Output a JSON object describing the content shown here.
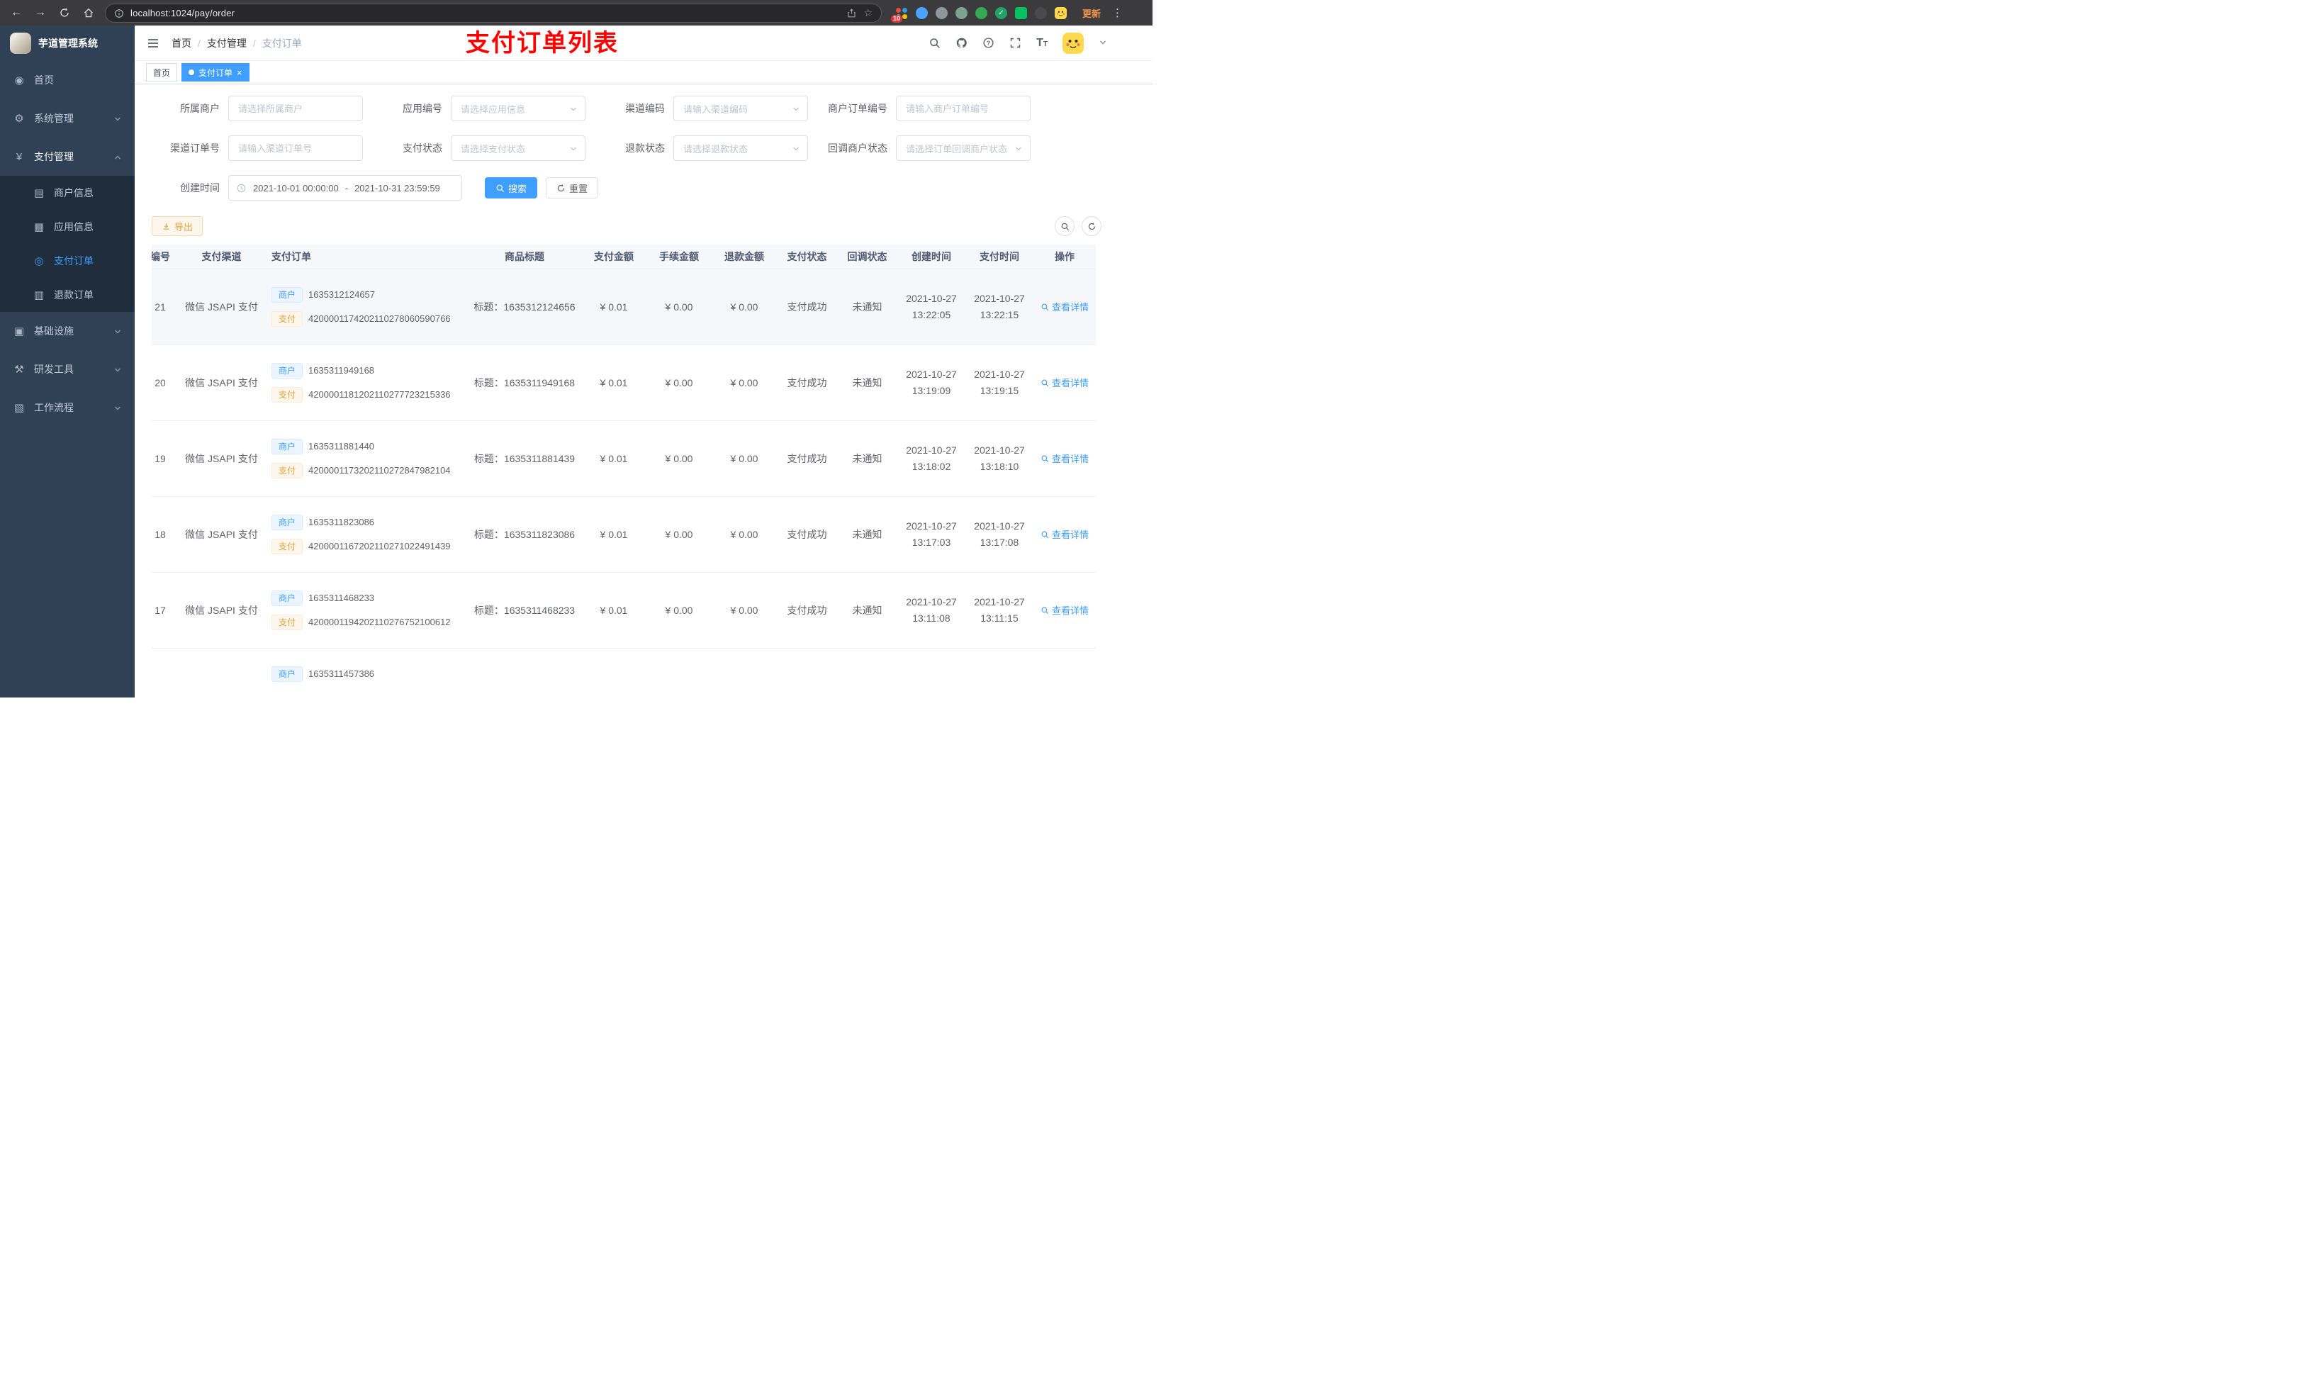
{
  "browser": {
    "url": "localhost:1024/pay/order",
    "extension_badge": "10",
    "update_label": "更新"
  },
  "icons": {
    "back": "←",
    "forward": "→",
    "star": "☆",
    "more": "⋮",
    "close": "×",
    "check": "✓",
    "font_size_large": "T",
    "font_size_small": "T",
    "menu_dashboard": "◉",
    "menu_system": "⚙",
    "menu_payment": "¥",
    "menu_merchant": "▤",
    "menu_app": "▦",
    "menu_pay_order": "◎",
    "menu_refund": "▥",
    "menu_infra": "▣",
    "menu_dev": "⚒",
    "menu_flow": "▧"
  },
  "sidebar": {
    "logo_title": "芋道管理系统",
    "home": "首页",
    "system": "系统管理",
    "payment": "支付管理",
    "merchant_info": "商户信息",
    "app_info": "应用信息",
    "pay_order": "支付订单",
    "refund_order": "退款订单",
    "infrastructure": "基础设施",
    "dev_tools": "研发工具",
    "workflow": "工作流程"
  },
  "header": {
    "breadcrumb_home": "首页",
    "breadcrumb_sep": "/",
    "breadcrumb_l1": "支付管理",
    "breadcrumb_l2": "支付订单",
    "page_title": "支付订单列表"
  },
  "tabs": {
    "home": "首页",
    "current": "支付订单"
  },
  "filters": {
    "fields": [
      {
        "label": "所属商户",
        "placeholder": "请选择所属商户"
      },
      {
        "label": "应用编号",
        "placeholder": "请选择应用信息"
      },
      {
        "label": "渠道编码",
        "placeholder": "请输入渠道编码"
      },
      {
        "label": "商户订单编号",
        "placeholder": "请输入商户订单编号"
      },
      {
        "label": "渠道订单号",
        "placeholder": "请输入渠道订单号"
      },
      {
        "label": "支付状态",
        "placeholder": "请选择支付状态"
      },
      {
        "label": "退款状态",
        "placeholder": "请选择退款状态"
      },
      {
        "label": "回调商户状态",
        "placeholder": "请选择订单回调商户状态"
      }
    ],
    "date_label": "创建时间",
    "date_start": "2021-10-01 00:00:00",
    "date_separator": "-",
    "date_end": "2021-10-31 23:59:59",
    "search_label": "搜索",
    "reset_label": "重置"
  },
  "toolbar": {
    "export_label": "导出"
  },
  "table": {
    "columns": [
      "编号",
      "支付渠道",
      "支付订单",
      "商品标题",
      "支付金额",
      "手续金额",
      "退款金额",
      "支付状态",
      "回调状态",
      "创建时间",
      "支付时间",
      "操作"
    ],
    "tags": {
      "merchant": "商户",
      "pay": "支付"
    },
    "rows": [
      {
        "id": "21",
        "channel": "微信 JSAPI 支付",
        "merchant_no": "1635312124657",
        "pay_no": "4200001174202110278060590766",
        "title": "标题：1635312124656",
        "amount": "¥ 0.01",
        "fee": "¥ 0.00",
        "refund": "¥ 0.00",
        "status": "支付成功",
        "notify": "未通知",
        "create_date": "2021-10-27",
        "create_time": "13:22:05",
        "pay_date": "2021-10-27",
        "pay_time": "13:22:15",
        "action": "查看详情"
      },
      {
        "id": "20",
        "channel": "微信 JSAPI 支付",
        "merchant_no": "1635311949168",
        "pay_no": "4200001181202110277723215336",
        "title": "标题：1635311949168",
        "amount": "¥ 0.01",
        "fee": "¥ 0.00",
        "refund": "¥ 0.00",
        "status": "支付成功",
        "notify": "未通知",
        "create_date": "2021-10-27",
        "create_time": "13:19:09",
        "pay_date": "2021-10-27",
        "pay_time": "13:19:15",
        "action": "查看详情"
      },
      {
        "id": "19",
        "channel": "微信 JSAPI 支付",
        "merchant_no": "1635311881440",
        "pay_no": "4200001173202110272847982104",
        "title": "标题：1635311881439",
        "amount": "¥ 0.01",
        "fee": "¥ 0.00",
        "refund": "¥ 0.00",
        "status": "支付成功",
        "notify": "未通知",
        "create_date": "2021-10-27",
        "create_time": "13:18:02",
        "pay_date": "2021-10-27",
        "pay_time": "13:18:10",
        "action": "查看详情"
      },
      {
        "id": "18",
        "channel": "微信 JSAPI 支付",
        "merchant_no": "1635311823086",
        "pay_no": "4200001167202110271022491439",
        "title": "标题：1635311823086",
        "amount": "¥ 0.01",
        "fee": "¥ 0.00",
        "refund": "¥ 0.00",
        "status": "支付成功",
        "notify": "未通知",
        "create_date": "2021-10-27",
        "create_time": "13:17:03",
        "pay_date": "2021-10-27",
        "pay_time": "13:17:08",
        "action": "查看详情"
      },
      {
        "id": "17",
        "channel": "微信 JSAPI 支付",
        "merchant_no": "1635311468233",
        "pay_no": "4200001194202110276752100612",
        "title": "标题：1635311468233",
        "amount": "¥ 0.01",
        "fee": "¥ 0.00",
        "refund": "¥ 0.00",
        "status": "支付成功",
        "notify": "未通知",
        "create_date": "2021-10-27",
        "create_time": "13:11:08",
        "pay_date": "2021-10-27",
        "pay_time": "13:11:15",
        "action": "查看详情"
      },
      {
        "merchant_no": "1635311457386"
      }
    ]
  },
  "colors": {
    "accent": "#409eff",
    "title_red": "#ff0000",
    "warning": "#e6a23c",
    "sidebar_bg": "#304156",
    "submenu_bg": "#1f2d3d"
  }
}
